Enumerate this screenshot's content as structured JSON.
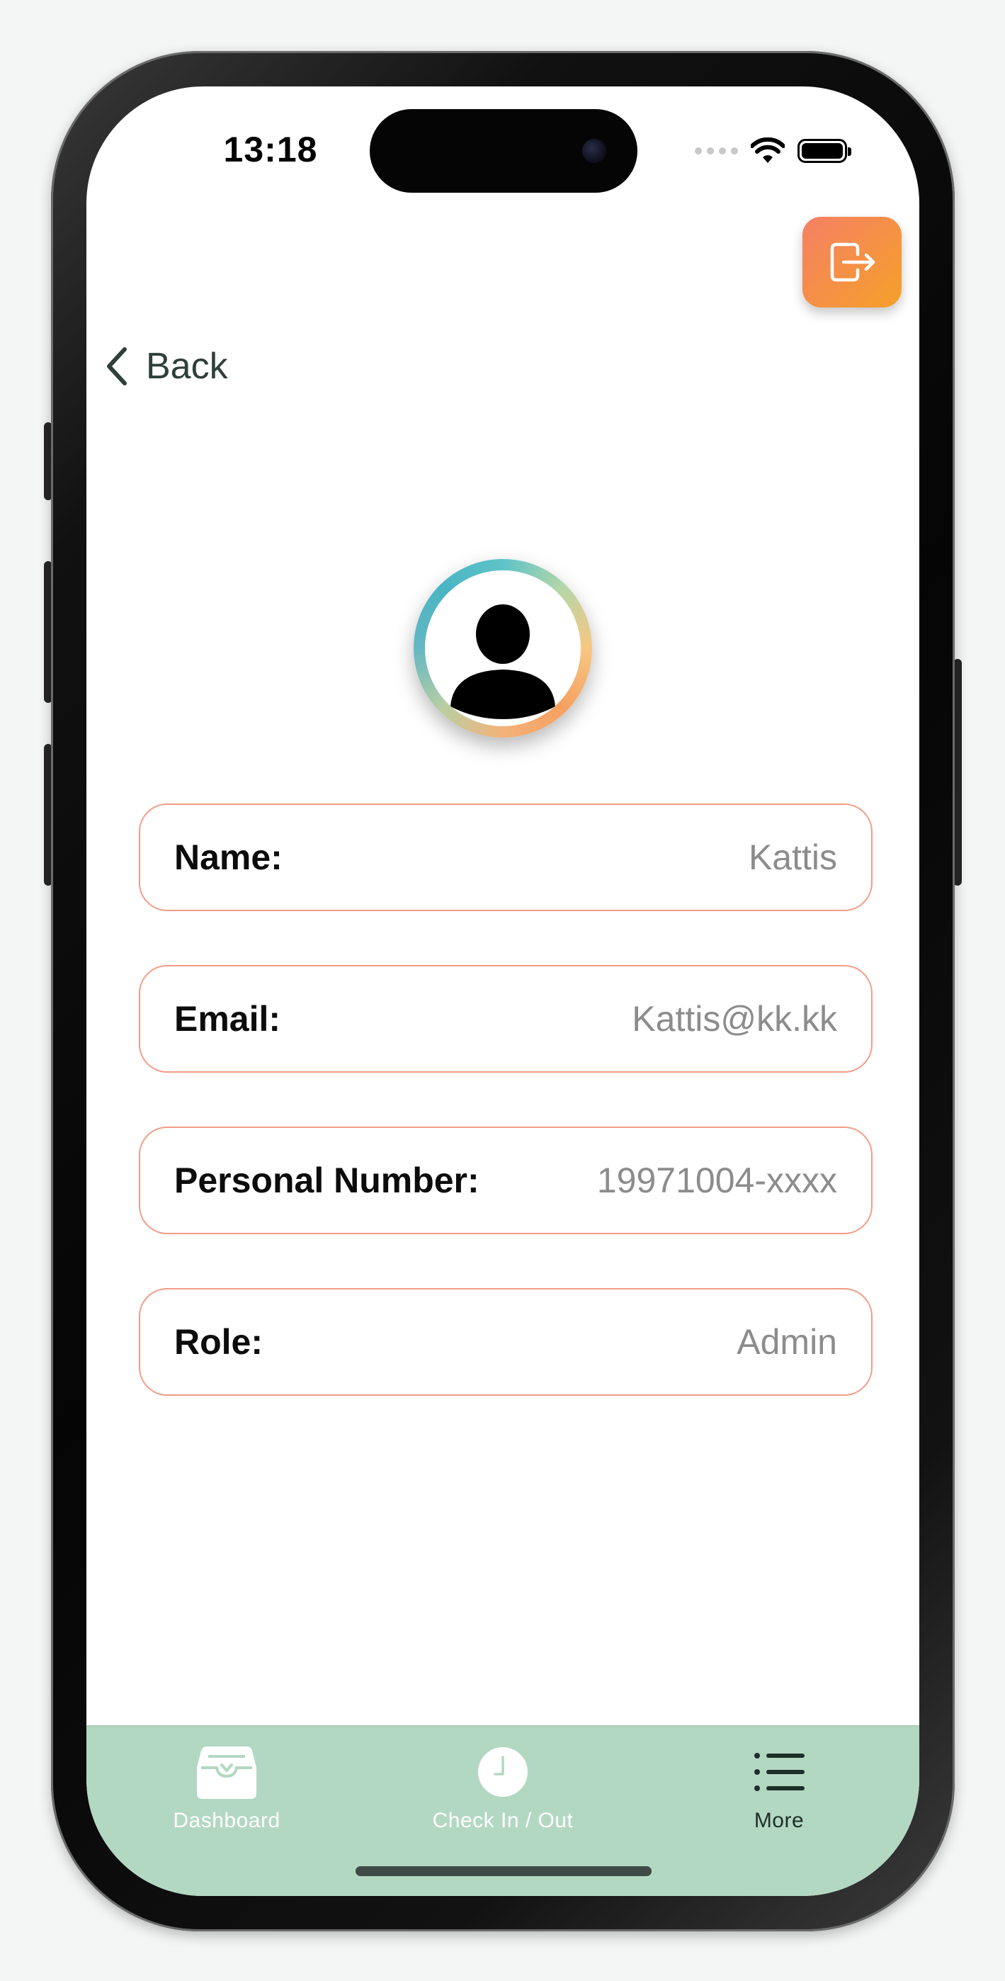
{
  "status_bar": {
    "time": "13:18"
  },
  "header": {
    "logout_icon": "logout-icon",
    "back_label": "Back"
  },
  "profile": {
    "avatar_icon": "person-icon",
    "fields": [
      {
        "label": "Name:",
        "value": "Kattis"
      },
      {
        "label": "Email:",
        "value": "Kattis@kk.kk"
      },
      {
        "label": "Personal Number:",
        "value": "19971004-xxxx"
      },
      {
        "label": "Role:",
        "value": "Admin"
      }
    ]
  },
  "tabbar": {
    "tabs": [
      {
        "label": "Dashboard",
        "icon": "tray-icon"
      },
      {
        "label": "Check In / Out",
        "icon": "clock-icon"
      },
      {
        "label": "More",
        "icon": "list-icon"
      }
    ],
    "active_tab": "More"
  },
  "colors": {
    "accent_gradient_start": "#f58064",
    "accent_gradient_end": "#f5a02a",
    "field_border": "#f29c86",
    "tabbar_bg": "#b3d8c2"
  }
}
